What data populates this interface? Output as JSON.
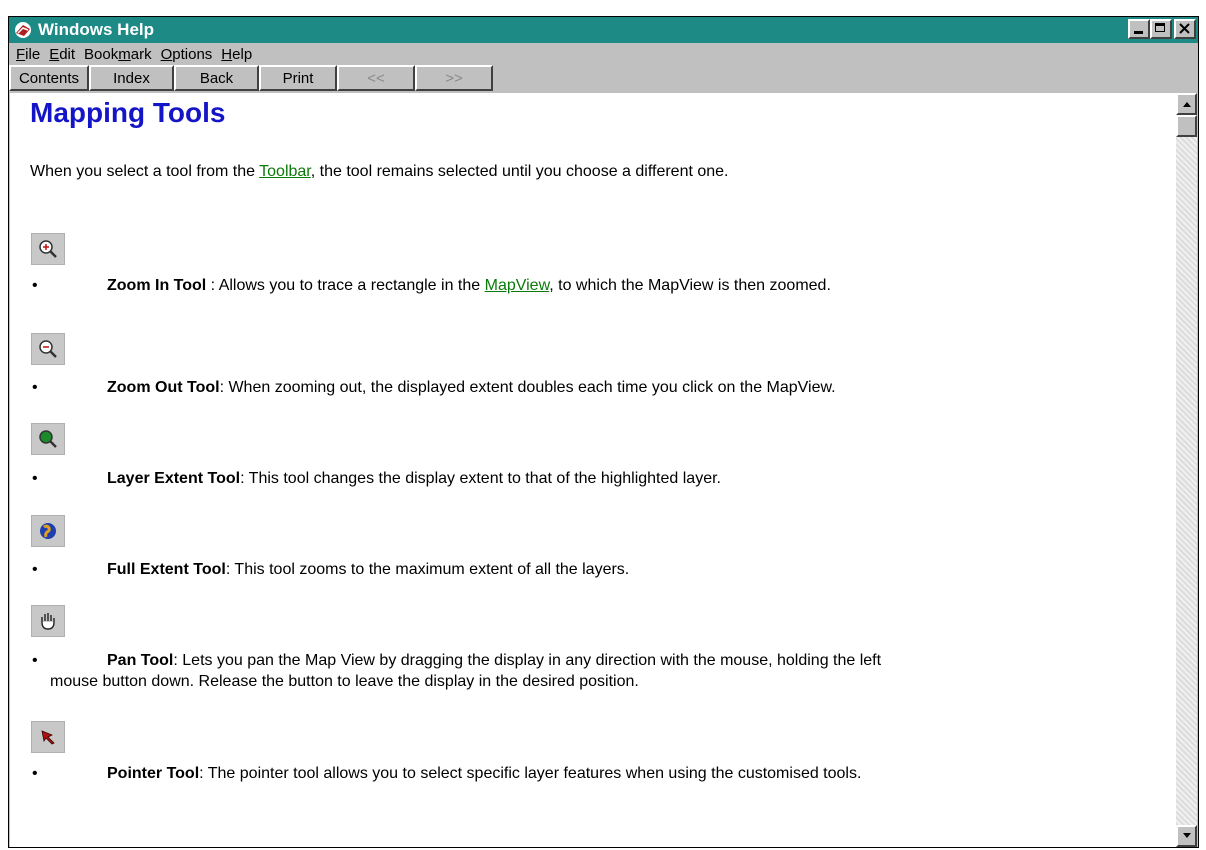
{
  "window": {
    "title": "Windows Help",
    "buttons": {
      "minimize": "minimize",
      "maximize": "maximize",
      "close": "close"
    }
  },
  "menu": [
    {
      "label": "File",
      "underline": "F",
      "rest": "ile"
    },
    {
      "label": "Edit",
      "underline": "E",
      "rest": "dit"
    },
    {
      "label": "Bookmark",
      "pre": "Book",
      "underline": "m",
      "rest": "ark"
    },
    {
      "label": "Options",
      "underline": "O",
      "rest": "ptions"
    },
    {
      "label": "Help",
      "underline": "H",
      "rest": "elp"
    }
  ],
  "toolbar": {
    "contents": "Contents",
    "index": "Index",
    "back": "Back",
    "print": "Print",
    "prev": "<<",
    "next": ">>"
  },
  "page": {
    "title": "Mapping Tools",
    "intro_before": "When you select a tool from the ",
    "intro_link": "Toolbar",
    "intro_after": ", the tool remains selected until you choose a different one.",
    "tools": [
      {
        "icon": "zoom-in-icon",
        "name": "Zoom In Tool",
        "sep": " : ",
        "desc_before": "Allows you to trace a rectangle in the ",
        "link": "MapView",
        "desc_after": ", to which the MapView is then zoomed."
      },
      {
        "icon": "zoom-out-icon",
        "name": "Zoom Out Tool",
        "sep": ": ",
        "desc": "When zooming out, the displayed extent doubles each time you click on the MapView."
      },
      {
        "icon": "layer-extent-icon",
        "name": "Layer Extent Tool",
        "sep": ": ",
        "desc": "This tool changes the display extent to that of the highlighted layer."
      },
      {
        "icon": "globe-icon",
        "name": "Full Extent Tool",
        "sep": ": ",
        "desc": "This tool zooms to the maximum extent of all the layers."
      },
      {
        "icon": "hand-icon",
        "name": "Pan Tool",
        "sep": ": ",
        "desc": "Lets you pan the Map View by dragging the display in any direction with the mouse, holding the left",
        "desc_line2": "mouse button down. Release the button to leave the display in the desired position."
      },
      {
        "icon": "pointer-icon",
        "name": "Pointer Tool",
        "sep": ": ",
        "desc": "The pointer tool allows you to select specific layer features when using the customised tools."
      }
    ],
    "bullet": "•"
  },
  "colors": {
    "titlebar": "#1d8a86",
    "heading": "#1515c8",
    "link": "#0a7a0a"
  }
}
